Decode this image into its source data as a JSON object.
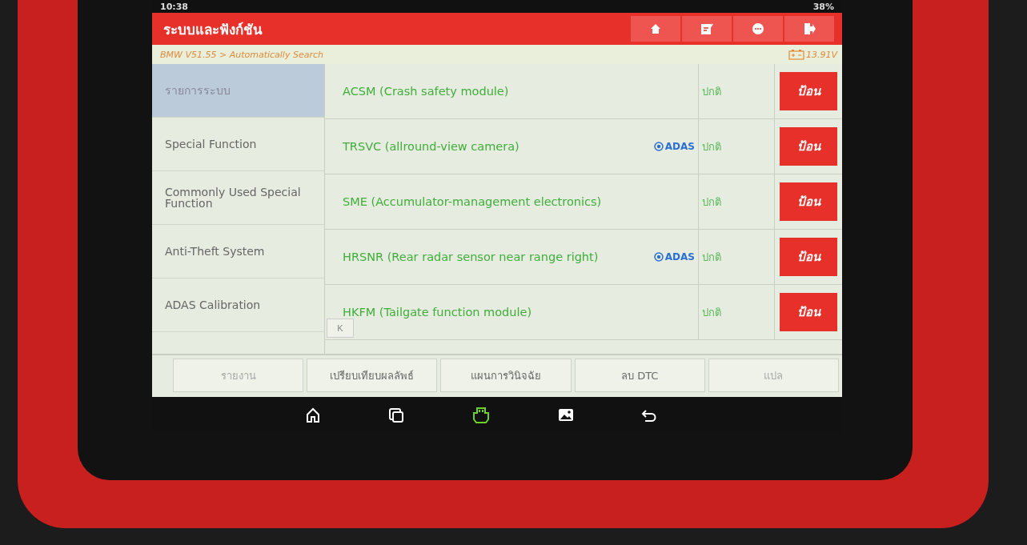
{
  "status_bar": {
    "time": "10:38",
    "battery": "38%"
  },
  "header": {
    "title": "ระบบและฟังก์ชัน",
    "actions": [
      {
        "kind": "home"
      },
      {
        "kind": "edit"
      },
      {
        "kind": "chat"
      },
      {
        "kind": "exit"
      }
    ]
  },
  "breadcrumb": {
    "path": "BMW V51.55 > Automatically Search",
    "voltage": "13.91V"
  },
  "sidebar": {
    "items": [
      {
        "label": "รายการระบบ",
        "selected": true
      },
      {
        "label": "Special Function",
        "selected": false
      },
      {
        "label": "Commonly Used Special Function",
        "selected": false
      },
      {
        "label": "Anti-Theft System",
        "selected": false
      },
      {
        "label": "ADAS Calibration",
        "selected": false
      }
    ],
    "collapse": "K"
  },
  "systems": [
    {
      "name": "ACSM (Crash safety module)",
      "status": "ปกติ",
      "button": "ป้อน"
    },
    {
      "name": "TRSVC (allround-view camera)",
      "tag": "ADAS",
      "status": "ปกติ",
      "button": "ป้อน"
    },
    {
      "name": "SME (Accumulator-management electronics)",
      "status": "ปกติ",
      "button": "ป้อน"
    },
    {
      "name": "HRSNR (Rear radar sensor near range right)",
      "tag": "ADAS",
      "status": "ปกติ",
      "button": "ป้อน"
    },
    {
      "name": "HKFM (Tailgate function module)",
      "status": "ปกติ",
      "button": "ป้อน"
    }
  ],
  "toolbar": [
    {
      "label": "รายงาน",
      "disabled": true
    },
    {
      "label": "เปรียบเทียบผลลัพธ์",
      "disabled": false
    },
    {
      "label": "แผนการวินิจฉัย",
      "disabled": false
    },
    {
      "label": "ลบ DTC",
      "disabled": false
    },
    {
      "label": "แปล",
      "disabled": true
    }
  ],
  "nav_bar": [
    {
      "kind": "home"
    },
    {
      "kind": "recent"
    },
    {
      "kind": "vci"
    },
    {
      "kind": "gallery"
    },
    {
      "kind": "back"
    }
  ]
}
